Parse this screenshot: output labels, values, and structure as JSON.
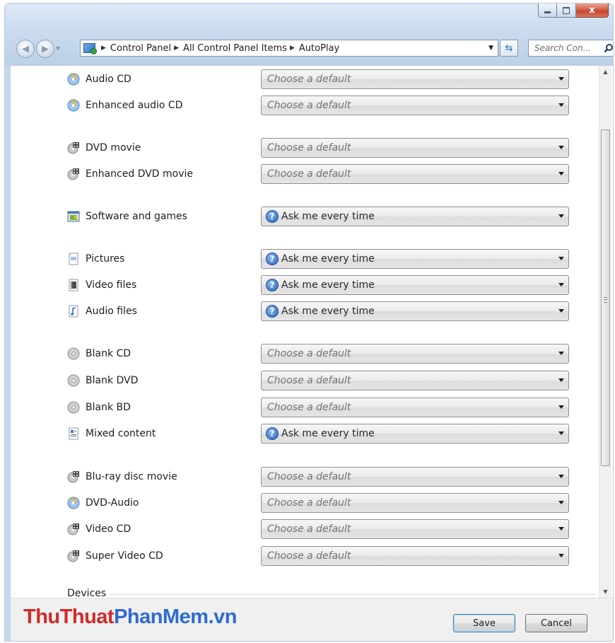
{
  "window": {
    "caption_buttons": {
      "minimize": "minimize-icon",
      "maximize": "maximize-icon",
      "close": "close-icon",
      "close_glyph": "x"
    }
  },
  "address_bar": {
    "breadcrumbs": [
      "Control Panel",
      "All Control Panel Items",
      "AutoPlay"
    ],
    "search_placeholder": "Search Con...",
    "icons": [
      "back-arrow-icon",
      "forward-arrow-icon",
      "control-panel-icon",
      "refresh-icon",
      "search-icon"
    ]
  },
  "rows": [
    {
      "label": "Audio CD",
      "icon": "audio-cd-icon",
      "value": "Choose a default",
      "state": "default"
    },
    {
      "label": "Enhanced audio CD",
      "icon": "audio-cd-icon",
      "value": "Choose a default",
      "state": "default"
    },
    {
      "label": "DVD movie",
      "icon": "dvd-movie-icon",
      "value": "Choose a default",
      "state": "default"
    },
    {
      "label": "Enhanced DVD movie",
      "icon": "dvd-movie-icon",
      "value": "Choose a default",
      "state": "default"
    },
    {
      "label": "Software and games",
      "icon": "software-icon",
      "value": "Ask me every time",
      "state": "ask"
    },
    {
      "label": "Pictures",
      "icon": "pictures-icon",
      "value": "Ask me every time",
      "state": "ask"
    },
    {
      "label": "Video files",
      "icon": "video-file-icon",
      "value": "Ask me every time",
      "state": "ask"
    },
    {
      "label": "Audio files",
      "icon": "audio-file-icon",
      "value": "Ask me every time",
      "state": "ask"
    },
    {
      "label": "Blank CD",
      "icon": "blank-disc-icon",
      "value": "Choose a default",
      "state": "default"
    },
    {
      "label": "Blank DVD",
      "icon": "blank-disc-icon",
      "value": "Choose a default",
      "state": "default"
    },
    {
      "label": "Blank BD",
      "icon": "blank-disc-icon",
      "value": "Choose a default",
      "state": "default"
    },
    {
      "label": "Mixed content",
      "icon": "mixed-content-icon",
      "value": "Ask me every time",
      "state": "ask"
    },
    {
      "label": "Blu-ray disc movie",
      "icon": "dvd-movie-icon",
      "value": "Choose a default",
      "state": "default"
    },
    {
      "label": "DVD-Audio",
      "icon": "audio-cd-icon",
      "value": "Choose a default",
      "state": "default"
    },
    {
      "label": "Video CD",
      "icon": "dvd-movie-icon",
      "value": "Choose a default",
      "state": "default"
    },
    {
      "label": "Super Video CD",
      "icon": "dvd-movie-icon",
      "value": "Choose a default",
      "state": "default"
    }
  ],
  "devices_header": "Devices",
  "footer": {
    "watermark_part1": "Thu",
    "watermark_part2": "Thuat",
    "watermark_part3": "PhanMem.vn",
    "save_label": "Save",
    "cancel_label": "Cancel"
  },
  "colors": {
    "frame": "#cadbee",
    "question_icon": "#2463b8",
    "watermark_red": "#d22a2a",
    "watermark_blue": "#2e6bd1"
  }
}
